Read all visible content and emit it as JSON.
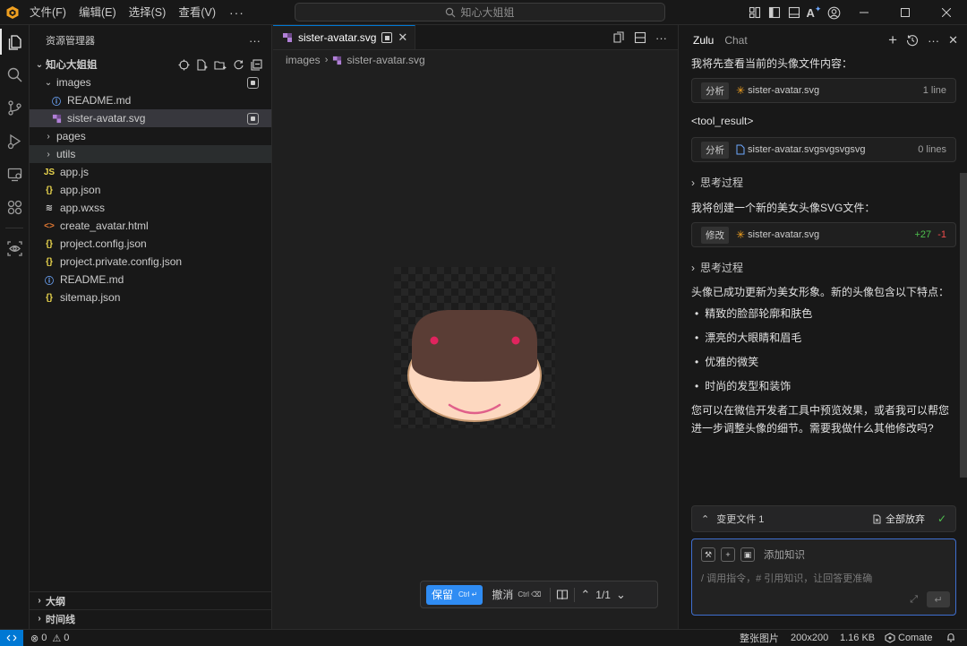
{
  "titlebar": {
    "menus": [
      "文件(F)",
      "编辑(E)",
      "选择(S)",
      "查看(V)"
    ],
    "more": "···",
    "search_placeholder": "知心大姐姐",
    "window_controls": [
      "minimize-icon",
      "maximize-icon",
      "close-icon"
    ]
  },
  "activitybar": {
    "items": [
      "explorer-icon",
      "search-icon",
      "source-control-icon",
      "run-debug-icon",
      "remote-icon",
      "extensions-icon",
      "preview-eye-icon"
    ]
  },
  "explorer": {
    "title": "资源管理器",
    "more": "···",
    "root": "知心大姐姐",
    "items": [
      {
        "label": "images",
        "type": "folder-open",
        "depth": 1
      },
      {
        "label": "README.md",
        "type": "info",
        "depth": 2
      },
      {
        "label": "sister-avatar.svg",
        "type": "svg",
        "depth": 2,
        "selected": true
      },
      {
        "label": "pages",
        "type": "folder",
        "depth": 1
      },
      {
        "label": "utils",
        "type": "folder",
        "depth": 1,
        "hover": true
      },
      {
        "label": "app.js",
        "type": "js",
        "depth": 1
      },
      {
        "label": "app.json",
        "type": "json",
        "depth": 1
      },
      {
        "label": "app.wxss",
        "type": "css",
        "depth": 1
      },
      {
        "label": "create_avatar.html",
        "type": "html",
        "depth": 1
      },
      {
        "label": "project.config.json",
        "type": "json",
        "depth": 1
      },
      {
        "label": "project.private.config.json",
        "type": "json",
        "depth": 1
      },
      {
        "label": "README.md",
        "type": "info",
        "depth": 1
      },
      {
        "label": "sitemap.json",
        "type": "json",
        "depth": 1
      }
    ],
    "outline": "大纲",
    "timeline": "时间线"
  },
  "editor": {
    "tab_label": "sister-avatar.svg",
    "breadcrumb": [
      "images",
      "sister-avatar.svg"
    ],
    "diffbar": {
      "keep": "保留",
      "keep_shortcut": "Ctrl ↵",
      "undo": "撤消",
      "undo_shortcut": "Ctrl ⌫",
      "page": "1/1"
    },
    "colors": {
      "hair": "#5a3d35",
      "face": "#fdd8c0",
      "outline": "#c89a72",
      "eyes": "#e0245e",
      "smile": "#e0608a"
    }
  },
  "chat": {
    "tabs": [
      "Zulu",
      "Chat"
    ],
    "messages": {
      "intro": "我将先查看当前的头像文件内容：",
      "card1": {
        "tag": "分析",
        "file": "sister-avatar.svg",
        "meta": "1 line"
      },
      "tool_result": "<tool_result>",
      "card2": {
        "tag": "分析",
        "file": "sister-avatar.svgsvgsvgsvg",
        "meta": "0 lines"
      },
      "think1": "思考过程",
      "create": "我将创建一个新的美女头像SVG文件：",
      "card3": {
        "tag": "修改",
        "file": "sister-avatar.svg",
        "added": "+27",
        "removed": "-1"
      },
      "think2": "思考过程",
      "summary": "头像已成功更新为美女形象。新的头像包含以下特点：",
      "bullets": [
        "精致的脸部轮廓和肤色",
        "漂亮的大眼睛和眉毛",
        "优雅的微笑",
        "时尚的发型和装饰"
      ],
      "closing": "您可以在微信开发者工具中预览效果，或者我可以帮您进一步调整头像的细节。需要我做什么其他修改吗?"
    },
    "changes": {
      "label": "变更文件 1",
      "discard_all": "全部放弃"
    },
    "composer": {
      "knowledge": "添加知识",
      "placeholder": "/ 调用指令，# 引用知识，让回答更准确"
    }
  },
  "statusbar": {
    "errors": "0",
    "warnings": "0",
    "image_type": "整张图片",
    "dimensions": "200x200",
    "size": "1.16 KB",
    "brand": "Comate"
  }
}
